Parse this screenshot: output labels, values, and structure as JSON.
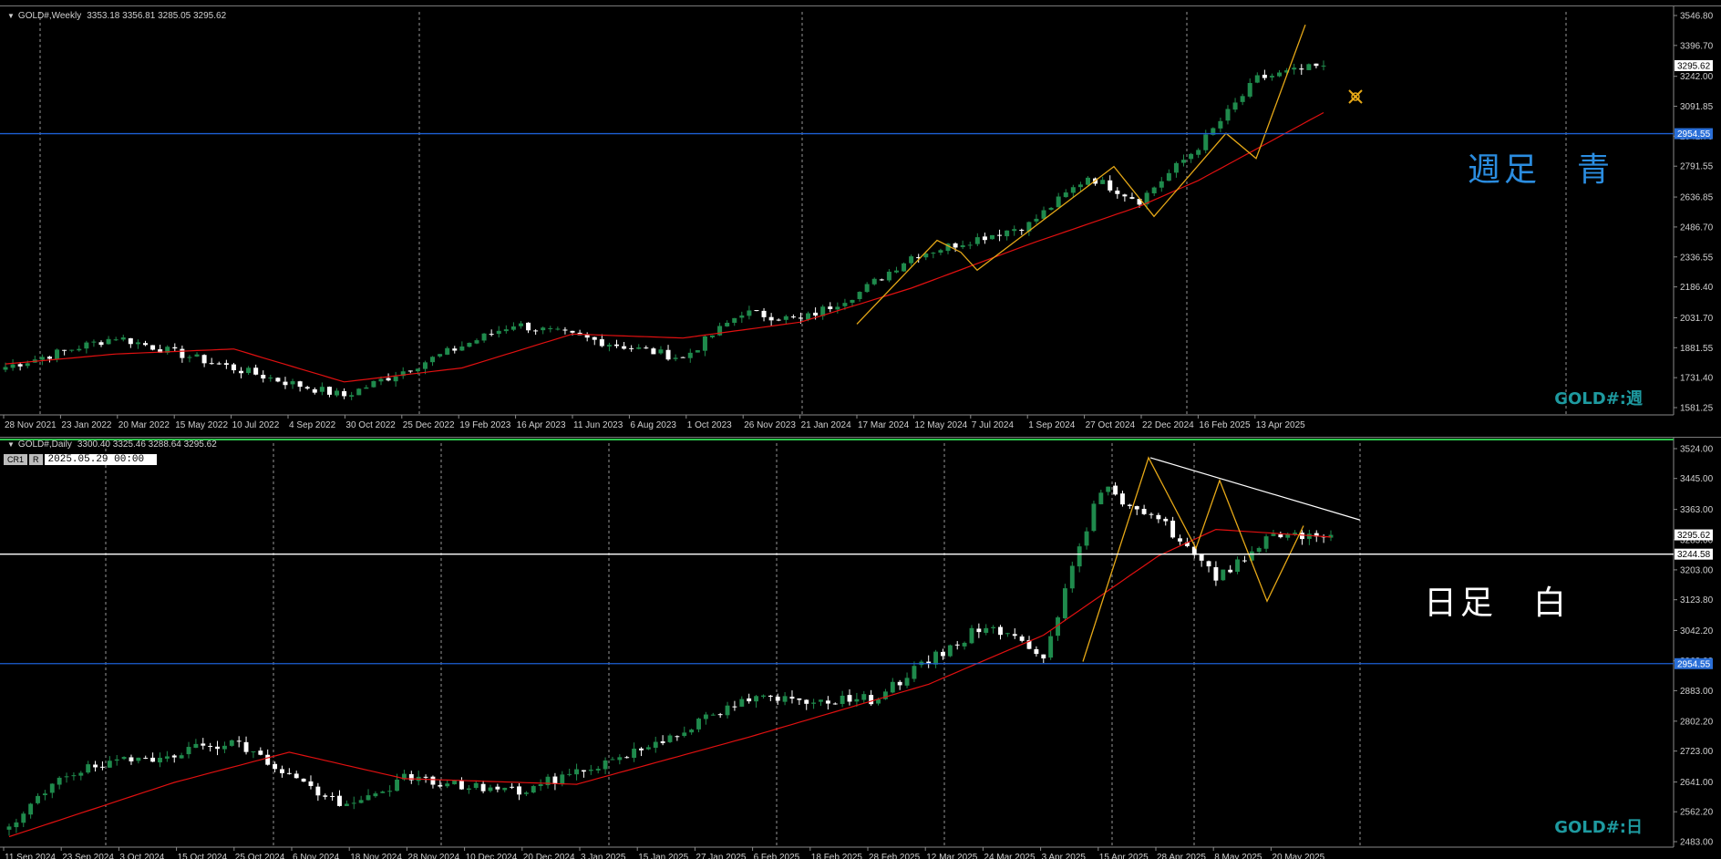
{
  "colors": {
    "background": "#000000",
    "grid": "#c8c8c8",
    "axis_text": "#cfcfcf",
    "bull_candle": "#1f8a4c",
    "bear_candle": "#ffffff",
    "moving_average": "#e01010",
    "zigzag": "#e6a817",
    "support_line": "#1c5fd4",
    "price_tag_bg": "#2a6fd8",
    "symbol_text": "#1e9aa0",
    "label_blue": "#2b8de0",
    "label_white": "#ffffff",
    "panel_accent": "#2ec44d"
  },
  "weekly": {
    "header_symbol": "GOLD#,Weekly",
    "header_ohlc": "3353.18 3356.81 3285.05 3295.62",
    "label_text": "週足　青",
    "symbol_text": "GOLD#:週",
    "current_price_tag": "3295.62",
    "hline_tag": "2954.55",
    "icon": "cursor-crosshair-icon"
  },
  "daily": {
    "header_symbol": "GOLD#,Daily",
    "header_ohlc": "3300.40 3325.46 3288.64 3295.62",
    "cr_tag": "CR1",
    "r_tag": "R",
    "date_box": "2025.05.29 00:00",
    "label_text": "日足　白",
    "symbol_text": "GOLD#:日",
    "current_price_tag": "3295.62",
    "hline_tag": "3244.58",
    "blue_hline_tag": "2954.55"
  },
  "chart_data": [
    {
      "type": "candlestick",
      "title": "GOLD#,Weekly",
      "timeframe": "weekly",
      "ylim": [
        1581.25,
        3546.8
      ],
      "y_ticks": [
        "3546.80",
        "3396.70",
        "3242.00",
        "3091.85",
        "2941.70",
        "2791.55",
        "2636.85",
        "2486.70",
        "2336.55",
        "2186.40",
        "2031.70",
        "1881.55",
        "1731.40",
        "1581.25"
      ],
      "x_ticks": [
        "28 Nov 2021",
        "23 Jan 2022",
        "20 Mar 2022",
        "15 May 2022",
        "10 Jul 2022",
        "4 Sep 2022",
        "30 Oct 2022",
        "25 Dec 2022",
        "19 Feb 2023",
        "16 Apr 2023",
        "11 Jun 2023",
        "6 Aug 2023",
        "1 Oct 2023",
        "26 Nov 2023",
        "21 Jan 2024",
        "17 Mar 2024",
        "12 May 2024",
        "7 Jul 2024",
        "1 Sep 2024",
        "27 Oct 2024",
        "22 Dec 2024",
        "16 Feb 2025",
        "13 Apr 2025"
      ],
      "key_closes": [
        {
          "x": "28 Nov 2021",
          "y": 1785
        },
        {
          "x": "20 Mar 2022",
          "y": 1935
        },
        {
          "x": "4 Sep 2022",
          "y": 1710
        },
        {
          "x": "30 Oct 2022",
          "y": 1640
        },
        {
          "x": "16 Apr 2023",
          "y": 2000
        },
        {
          "x": "1 Oct 2023",
          "y": 1830
        },
        {
          "x": "26 Nov 2023",
          "y": 2060
        },
        {
          "x": "21 Jan 2024",
          "y": 2020
        },
        {
          "x": "17 Mar 2024",
          "y": 2160
        },
        {
          "x": "12 May 2024",
          "y": 2340
        },
        {
          "x": "1 Sep 2024",
          "y": 2500
        },
        {
          "x": "27 Oct 2024",
          "y": 2740
        },
        {
          "x": "22 Dec 2024",
          "y": 2620
        },
        {
          "x": "16 Feb 2025",
          "y": 2890
        },
        {
          "x": "13 Apr 2025",
          "y": 3230
        },
        {
          "x": "last",
          "y": 3295.62
        }
      ],
      "ma_series": [
        {
          "x": "28 Nov 2021",
          "y": 1800
        },
        {
          "x": "20 Mar 2022",
          "y": 1850
        },
        {
          "x": "10 Jul 2022",
          "y": 1875
        },
        {
          "x": "30 Oct 2022",
          "y": 1710
        },
        {
          "x": "19 Feb 2023",
          "y": 1780
        },
        {
          "x": "11 Jun 2023",
          "y": 1950
        },
        {
          "x": "1 Oct 2023",
          "y": 1930
        },
        {
          "x": "21 Jan 2024",
          "y": 2010
        },
        {
          "x": "12 May 2024",
          "y": 2180
        },
        {
          "x": "1 Sep 2024",
          "y": 2400
        },
        {
          "x": "22 Dec 2024",
          "y": 2590
        },
        {
          "x": "16 Feb 2025",
          "y": 2720
        },
        {
          "x": "last",
          "y": 3060
        }
      ],
      "zigzag": [
        {
          "x": "21 Jan 2024",
          "y": 2000
        },
        {
          "x": "17 Mar 2024",
          "y": 2420
        },
        {
          "x": "12 May 2024",
          "y": 2360
        },
        {
          "x": "7 Jul 2024",
          "y": 2270
        },
        {
          "x": "27 Oct 2024",
          "y": 2790
        },
        {
          "x": "22 Dec 2024",
          "y": 2540
        },
        {
          "x": "16 Feb 2025",
          "y": 2956
        },
        {
          "x": "mar 2025",
          "y": 2830
        },
        {
          "x": "13 Apr 2025",
          "y": 3500
        }
      ],
      "horizontal_line": 2954.55,
      "last_price": 3295.62
    },
    {
      "type": "candlestick",
      "title": "GOLD#,Daily",
      "timeframe": "daily",
      "ylim": [
        2483.0,
        3524.0
      ],
      "y_ticks": [
        "3524.00",
        "3445.00",
        "3363.00",
        "3283.00",
        "3203.00",
        "3123.80",
        "3042.20",
        "2962.00",
        "2883.00",
        "2802.20",
        "2723.00",
        "2641.00",
        "2562.20",
        "2483.00"
      ],
      "x_ticks": [
        "11 Sep 2024",
        "23 Sep 2024",
        "3 Oct 2024",
        "15 Oct 2024",
        "25 Oct 2024",
        "6 Nov 2024",
        "18 Nov 2024",
        "28 Nov 2024",
        "10 Dec 2024",
        "20 Dec 2024",
        "3 Jan 2025",
        "15 Jan 2025",
        "27 Jan 2025",
        "6 Feb 2025",
        "18 Feb 2025",
        "28 Feb 2025",
        "12 Mar 2025",
        "24 Mar 2025",
        "3 Apr 2025",
        "15 Apr 2025",
        "28 Apr 2025",
        "8 May 2025",
        "20 May 2025"
      ],
      "key_closes": [
        {
          "x": "11 Sep 2024",
          "y": 2510
        },
        {
          "x": "23 Sep 2024",
          "y": 2660
        },
        {
          "x": "25 Oct 2024",
          "y": 2750
        },
        {
          "x": "18 Nov 2024",
          "y": 2570
        },
        {
          "x": "28 Nov 2024",
          "y": 2650
        },
        {
          "x": "20 Dec 2024",
          "y": 2615
        },
        {
          "x": "15 Jan 2025",
          "y": 2720
        },
        {
          "x": "6 Feb 2025",
          "y": 2860
        },
        {
          "x": "28 Feb 2025",
          "y": 2860
        },
        {
          "x": "24 Mar 2025",
          "y": 3060
        },
        {
          "x": "3 Apr 2025",
          "y": 2980
        },
        {
          "x": "15 Apr 2025",
          "y": 3420
        },
        {
          "x": "28 Apr 2025",
          "y": 3340
        },
        {
          "x": "8 May 2025",
          "y": 3180
        },
        {
          "x": "20 May 2025",
          "y": 3300
        },
        {
          "x": "last",
          "y": 3295.62
        }
      ],
      "ma_series": [
        {
          "x": "11 Sep 2024",
          "y": 2490
        },
        {
          "x": "15 Oct 2024",
          "y": 2640
        },
        {
          "x": "6 Nov 2024",
          "y": 2720
        },
        {
          "x": "28 Nov 2024",
          "y": 2650
        },
        {
          "x": "3 Jan 2025",
          "y": 2635
        },
        {
          "x": "6 Feb 2025",
          "y": 2760
        },
        {
          "x": "12 Mar 2025",
          "y": 2900
        },
        {
          "x": "3 Apr 2025",
          "y": 3030
        },
        {
          "x": "28 Apr 2025",
          "y": 3240
        },
        {
          "x": "8 May 2025",
          "y": 3310
        },
        {
          "x": "last",
          "y": 3290
        }
      ],
      "zigzag": [
        {
          "x": "3 Apr 2025",
          "y": 2960
        },
        {
          "x": "15 Apr 2025",
          "y": 3500
        },
        {
          "x": "28 Apr 2025",
          "y": 3260
        },
        {
          "x": "late Apr 2025",
          "y": 3440
        },
        {
          "x": "15 May 2025",
          "y": 3120
        },
        {
          "x": "20 May 2025",
          "y": 3320
        }
      ],
      "trendline": [
        {
          "x": "15 Apr 2025",
          "y": 3500
        },
        {
          "x": "end",
          "y": 3335
        }
      ],
      "horizontal_lines": [
        3244.58,
        2954.55
      ],
      "last_price": 3295.62
    }
  ]
}
